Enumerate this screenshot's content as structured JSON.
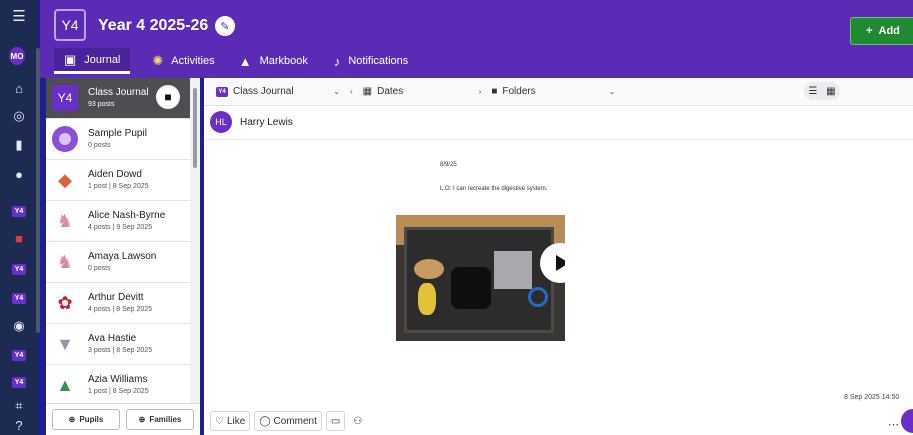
{
  "header": {
    "class_badge": "Y4",
    "title": "Year 4 2025-26",
    "add_label": "Add",
    "tabs": [
      {
        "label": "Journal",
        "icon": "journal-icon",
        "active": true
      },
      {
        "label": "Activities",
        "icon": "lightbulb-icon",
        "active": false
      },
      {
        "label": "Markbook",
        "icon": "graduation-cap-icon",
        "active": false
      },
      {
        "label": "Notifications",
        "icon": "bell-icon",
        "active": false
      }
    ]
  },
  "rail": {
    "user_initials": "MO",
    "class_badges": [
      "Y4",
      "Y4",
      "Y4",
      "Y4",
      "Y4"
    ]
  },
  "list": {
    "items": [
      {
        "name": "Class Journal",
        "sub": "93 posts",
        "avatar": "Y4"
      },
      {
        "name": "Sample Pupil",
        "sub": "0 posts"
      },
      {
        "name": "Aiden Dowd",
        "sub": "1 post | 8 Sep 2025"
      },
      {
        "name": "Alice Nash-Byrne",
        "sub": "4 posts | 9 Sep 2025"
      },
      {
        "name": "Amaya Lawson",
        "sub": "0 posts"
      },
      {
        "name": "Arthur Devitt",
        "sub": "4 posts | 8 Sep 2025"
      },
      {
        "name": "Ava Hastie",
        "sub": "3 posts | 8 Sep 2025"
      },
      {
        "name": "Azia Williams",
        "sub": "1 post | 8 Sep 2025"
      }
    ],
    "footer": {
      "pupils_label": "Pupils",
      "families_label": "Families"
    }
  },
  "toolbar": {
    "journal_select": "Class Journal",
    "dates_label": "Dates",
    "folders_label": "Folders"
  },
  "post": {
    "author_initials": "HL",
    "author_name": "Harry Lewis",
    "date_text": "8/9/25",
    "body_text": "L.O: I can recreate the digestive system.",
    "timestamp": "8 Sep 2025 14:50",
    "like_label": "Like",
    "comment_label": "Comment"
  },
  "colors": {
    "brand_purple": "#5b2bb6",
    "add_green": "#1f8a32",
    "selected_row": "#4e4e52"
  }
}
